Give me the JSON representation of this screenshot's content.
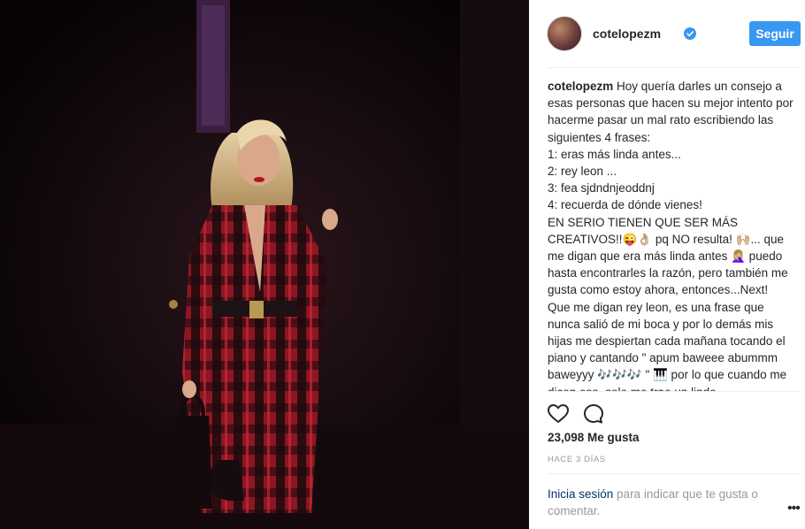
{
  "post": {
    "username": "cotelopezm",
    "follow_label": "Seguir",
    "caption_user": "cotelopezm",
    "caption_text": " Hoy quería darles un consejo a esas personas que hacen su mejor intento por hacerme pasar un mal rato escribiendo las siguientes 4 frases:\n1: eras más linda antes...\n2: rey leon ...\n3: fea sjdndnjeoddnj\n4: recuerda de dónde vienes!\nEN SERIO TIENEN QUE SER MÁS CREATIVOS!!😜👌🏼 pq NO resulta! 🙌🏼... que me digan que era más linda antes 🤦🏼‍♀️ puedo hasta encontrarles la razón, pero también me gusta como estoy ahora, entonces...Next!\nQue me digan rey leon, es una frase que nunca salió de mi boca y por lo demás mis hijas me despiertan cada mañana tocando el piano y cantando \" apum baweee abummm baweyyy 🎶🎶🎶 \" 🎹 por lo que cuando me dicen eso, solo me trae un lindo",
    "likes": "23,098 Me gusta",
    "time_ago": "HACE 3 DÍAS",
    "login_link": "Inicia sesión",
    "login_rest": " para indicar que te gusta o comentar.",
    "more_label": "•••"
  },
  "icons": {
    "verified": "verified-badge-icon",
    "like": "heart-icon",
    "comment": "comment-bubble-icon",
    "more": "more-options-icon"
  },
  "colors": {
    "follow_button": "#3897f0",
    "verified_badge": "#3897f0",
    "link": "#003569",
    "muted": "#999999"
  }
}
